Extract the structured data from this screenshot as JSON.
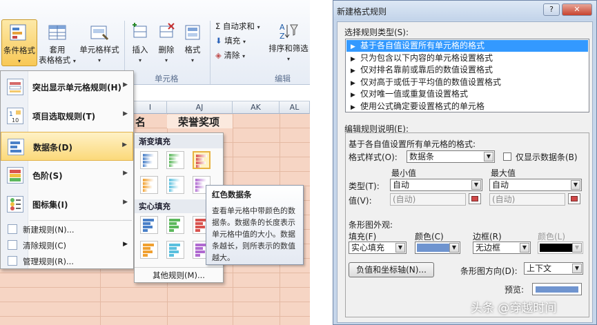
{
  "excel": {
    "ribbon": {
      "cond_format": "条件格式",
      "format_table_l1": "套用",
      "format_table_l2": "表格格式",
      "cell_styles": "单元格样式",
      "insert": "插入",
      "delete": "删除",
      "format": "格式",
      "group_cells": "单元格",
      "autosum": "Σ 自动求和",
      "fill": "填充",
      "clear": "清除",
      "sort_filter": "排序和筛选",
      "group_edit": "编辑"
    },
    "columns": [
      "I",
      "AJ",
      "AK",
      "AL"
    ],
    "cells": {
      "c1": "名",
      "c2": "荣誉奖项"
    },
    "menu": {
      "items": [
        {
          "label": "突出显示单元格规则(H)",
          "icon": "highlight-cells-icon"
        },
        {
          "label": "项目选取规则(T)",
          "icon": "top-bottom-icon"
        },
        {
          "label": "数据条(D)",
          "icon": "data-bars-icon"
        },
        {
          "label": "色阶(S)",
          "icon": "color-scales-icon"
        },
        {
          "label": "图标集(I)",
          "icon": "icon-sets-icon"
        }
      ],
      "small_items": [
        {
          "label": "新建规则(N)..."
        },
        {
          "label": "清除规则(C)"
        },
        {
          "label": "管理规则(R)..."
        }
      ]
    },
    "submenu": {
      "gradient_header": "渐变填充",
      "solid_header": "实心填充",
      "other_rules": "其他规则(M)..."
    },
    "tooltip": {
      "title": "红色数据条",
      "body": "查看单元格中带颜色的数据条。数据条的长度表示单元格中值的大小。数据条越长，则所表示的数值越大。"
    }
  },
  "dialog": {
    "title": "新建格式规则",
    "help_btn": "?",
    "close_btn": "✕",
    "rule_type_label": "选择规则类型(S):",
    "rule_types": [
      "基于各自值设置所有单元格的格式",
      "只为包含以下内容的单元格设置格式",
      "仅对排名靠前或靠后的数值设置格式",
      "仅对高于或低于平均值的数值设置格式",
      "仅对唯一值或重复值设置格式",
      "使用公式确定要设置格式的单元格"
    ],
    "selected_rule": 0,
    "desc_label": "编辑规则说明(E):",
    "desc_heading": "基于各自值设置所有单元格的格式:",
    "format_style_label": "格式样式(O):",
    "format_style_value": "数据条",
    "show_bar_only": "仅显示数据条(B)",
    "min_label": "最小值",
    "max_label": "最大值",
    "type_label": "类型(T):",
    "min_type": "自动",
    "max_type": "自动",
    "value_label": "值(V):",
    "min_value": "(自动)",
    "max_value": "(自动)",
    "bar_appearance": "条形图外观:",
    "fill_label": "填充(F)",
    "fill_value": "实心填充",
    "color_label": "颜色(C)",
    "bar_color": "#6f94cf",
    "border_label": "边框(R)",
    "border_value": "无边框",
    "border_color_label": "颜色(L)",
    "border_color": "#000000",
    "neg_axis_button": "负值和坐标轴(N)...",
    "direction_label": "条形图方向(D):",
    "direction_value": "上下文",
    "preview_label": "预览:"
  },
  "watermark": "头条 @穿越时间"
}
